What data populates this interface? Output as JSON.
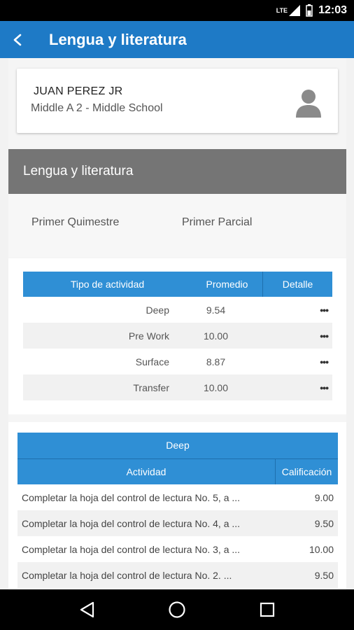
{
  "status_bar": {
    "network": "LTE",
    "time": "12:03"
  },
  "app_bar": {
    "title": "Lengua y literatura",
    "back_icon": "arrow-left-icon"
  },
  "student": {
    "name": "JUAN PEREZ JR",
    "class": "Middle A 2 - Middle School",
    "avatar_icon": "person-icon"
  },
  "subject": {
    "title": "Lengua y literatura"
  },
  "periods": {
    "quimestre": "Primer Quimestre",
    "parcial": "Primer Parcial"
  },
  "summary": {
    "headers": {
      "tipo": "Tipo de actividad",
      "promedio": "Promedio",
      "detalle": "Detalle"
    },
    "rows": [
      {
        "tipo": "Deep",
        "promedio": "9.54",
        "detalle": "•••"
      },
      {
        "tipo": "Pre Work",
        "promedio": "10.00",
        "detalle": "•••"
      },
      {
        "tipo": "Surface",
        "promedio": "8.87",
        "detalle": "•••"
      },
      {
        "tipo": "Transfer",
        "promedio": "10.00",
        "detalle": "•••"
      }
    ]
  },
  "detail": {
    "title": "Deep",
    "headers": {
      "actividad": "Actividad",
      "calificacion": "Calificación"
    },
    "rows": [
      {
        "actividad": "Completar la hoja del control de lectura No. 5, a ...",
        "calificacion": "9.00"
      },
      {
        "actividad": "Completar la hoja del control de lectura No. 4, a ...",
        "calificacion": "9.50"
      },
      {
        "actividad": "Completar la hoja del control de lectura No. 3, a ...",
        "calificacion": "10.00"
      },
      {
        "actividad": "Completar la hoja del control de lectura No. 2. ...",
        "calificacion": "9.50"
      }
    ]
  },
  "nav": {
    "back": "nav-back-icon",
    "home": "nav-home-icon",
    "recents": "nav-recents-icon"
  },
  "colors": {
    "primary": "#1e7ac6",
    "table_header": "#2f8fd5",
    "subject_bar": "#757575"
  }
}
